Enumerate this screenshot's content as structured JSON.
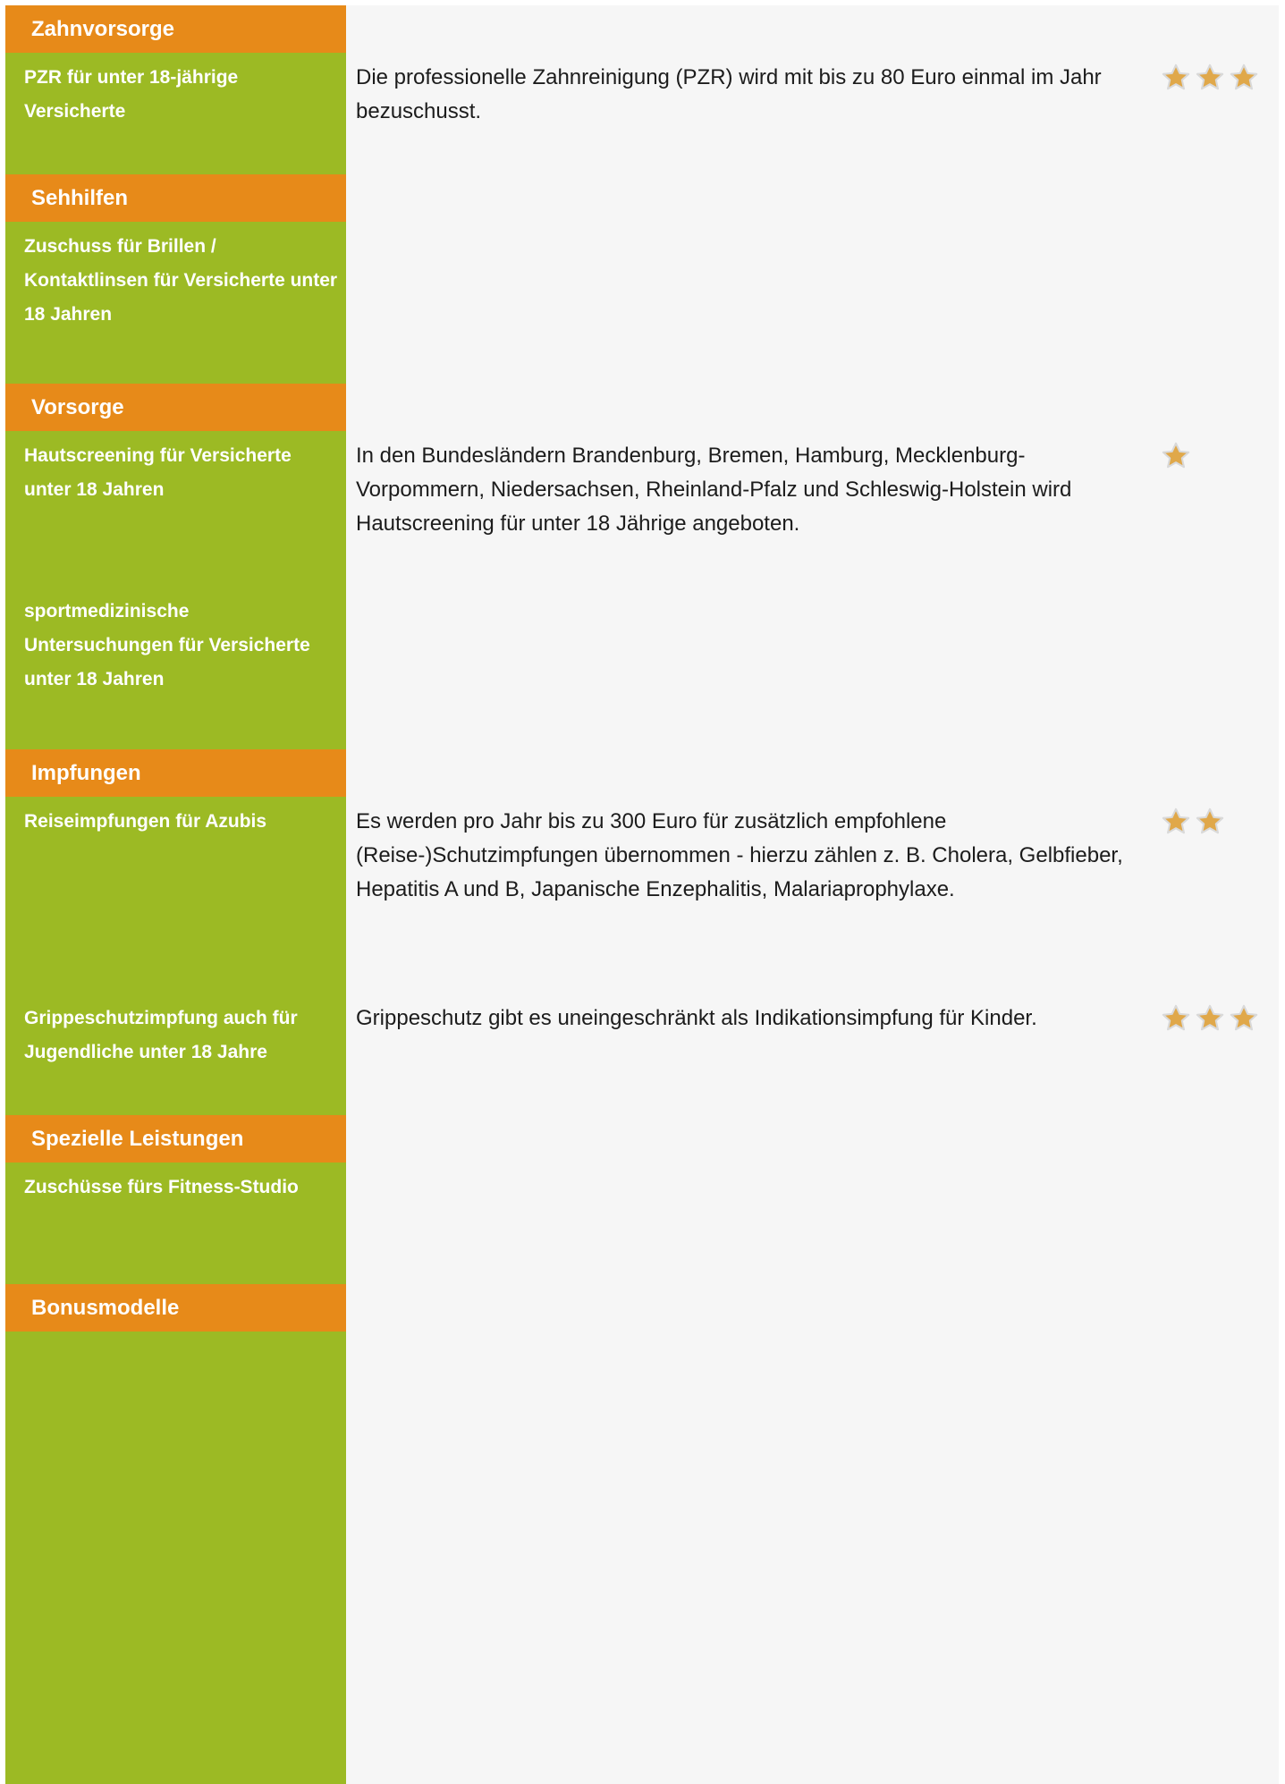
{
  "sections": {
    "zahnvorsorge": "Zahnvorsorge",
    "sehhilfen": "Sehhilfen",
    "vorsorge": "Vorsorge",
    "impfungen": "Impfungen",
    "spezielle": "Spezielle Leistungen",
    "bonusmodelle": "Bonusmodelle"
  },
  "rows": {
    "pzr": {
      "label": "PZR für unter 18-jährige Versicherte",
      "description": "Die professionelle Zahnreinigung (PZR) wird mit bis zu 80 Euro einmal im Jahr bezuschusst.",
      "rating": 3
    },
    "brillen": {
      "label": "Zuschuss für Brillen / Kontaktlinsen für Versicherte unter 18 Jahren",
      "description": "",
      "rating": 0
    },
    "hautscreening": {
      "label": "Hautscreening für Versicherte unter 18 Jahren",
      "description": "In den Bundesländern Brandenburg, Bremen, Hamburg, Mecklenburg-Vorpommern, Niedersachsen, Rheinland-Pfalz und Schleswig-Holstein wird Hautscreening für unter 18 Jährige angeboten.",
      "rating": 1
    },
    "sportmedizin": {
      "label": "sportmedizinische Untersuchungen für Versicherte unter 18 Jahren",
      "description": "",
      "rating": 0
    },
    "reiseimpfungen": {
      "label": "Reiseimpfungen für Azubis",
      "description": "Es werden pro Jahr bis zu 300 Euro für zusätzlich empfohlene (Reise-)Schutzimpfungen übernommen - hierzu zählen z. B. Cholera, Gelbfieber, Hepatitis A und B, Japanische Enzephalitis, Malariaprophylaxe.",
      "rating": 2
    },
    "grippeschutz": {
      "label": "Grippeschutzimpfung auch für Jugendliche unter 18 Jahre",
      "description": "Grippeschutz gibt es uneingeschränkt als Indikationsimpfung für Kinder.",
      "rating": 3
    },
    "fitness": {
      "label": "Zuschüsse fürs Fitness-Studio",
      "description": "",
      "rating": 0
    }
  },
  "colors": {
    "header_orange": "#e78a19",
    "sidebar_green": "#9cba24",
    "content_background": "#f6f6f6",
    "star_fill": "#e0a84a"
  },
  "icons": {
    "rating": "star-icon"
  }
}
